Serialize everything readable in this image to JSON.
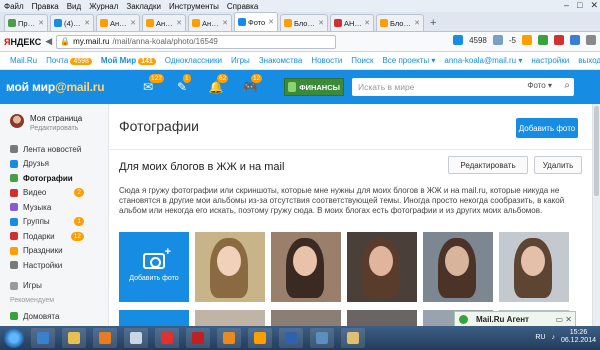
{
  "menubar": {
    "items": [
      "Файл",
      "Правка",
      "Вид",
      "Журнал",
      "Закладки",
      "Инструменты",
      "Справка"
    ]
  },
  "tabs": [
    {
      "label": "Прокурат",
      "icon_color": "#4a9e4a",
      "active": false
    },
    {
      "label": "(4) Входя",
      "icon_color": "#168de2",
      "active": false
    },
    {
      "label": "Анна Вяч",
      "icon_color": "#ff9e00",
      "active": false
    },
    {
      "label": "Анна Вяч",
      "icon_color": "#ff9e00",
      "active": false
    },
    {
      "label": "Анна Вяч",
      "icon_color": "#ff9e00",
      "active": false
    },
    {
      "label": "Фото",
      "icon_color": "#168de2",
      "active": true
    },
    {
      "label": "Блог. Ксен",
      "icon_color": "#ff9e00",
      "active": false
    },
    {
      "label": "АННА ВЯ",
      "icon_color": "#d03030",
      "active": false
    },
    {
      "label": "Блог. Ксен",
      "icon_color": "#ff9e00",
      "active": false
    }
  ],
  "addressbar": {
    "logo_red": "Я",
    "logo_rest": "НДЕКС",
    "host": "my.mail.ru",
    "path": "/mail/anna-koala/photo/16549",
    "mail_count": "4598",
    "temp": "-5"
  },
  "mrnav": {
    "items": [
      {
        "label": "Mail.Ru",
        "bold": false
      },
      {
        "label": "Почта",
        "badge": "4598"
      },
      {
        "label": "Мой Мир",
        "bold": true,
        "badge": "141"
      },
      {
        "label": "Одноклассники"
      },
      {
        "label": "Игры"
      },
      {
        "label": "Знакомства"
      },
      {
        "label": "Новости"
      },
      {
        "label": "Поиск"
      },
      {
        "label": "Все проекты ▾"
      }
    ],
    "user_email": "anna-koala@mail.ru ▾",
    "settings": "настройки",
    "logout": "выход"
  },
  "header": {
    "logo_main": "мой мир",
    "logo_accent": "@mail.ru",
    "icons": [
      {
        "name": "chat-icon",
        "glyph": "✉",
        "count": "122"
      },
      {
        "name": "notifications-icon",
        "glyph": "✎",
        "count": "1"
      },
      {
        "name": "bell-icon",
        "glyph": "🔔",
        "count": "62"
      },
      {
        "name": "games-icon",
        "glyph": "🎮",
        "count": "12"
      }
    ],
    "finance_label": "ФИНАНСЫ",
    "search_placeholder": "Искать в мире",
    "search_scope": "Фото ▾"
  },
  "sidebar": {
    "profile_name": "Моя страница",
    "profile_edit": "Редактировать",
    "items": [
      {
        "label": "Лента новостей",
        "color": "#7a7a7a",
        "badge": ""
      },
      {
        "label": "Друзья",
        "color": "#168de2",
        "badge": ""
      },
      {
        "label": "Фотографии",
        "color": "#4a9e4a",
        "badge": "",
        "active": true
      },
      {
        "label": "Видео",
        "color": "#d03030",
        "badge": "2"
      },
      {
        "label": "Музыка",
        "color": "#8a5ad0",
        "badge": ""
      },
      {
        "label": "Группы",
        "color": "#168de2",
        "badge": "1"
      },
      {
        "label": "Подарки",
        "color": "#d03030",
        "badge": "12"
      },
      {
        "label": "Праздники",
        "color": "#ff9e00",
        "badge": ""
      },
      {
        "label": "Настройки",
        "color": "#7a7a7a",
        "badge": ""
      }
    ],
    "games": "Игры",
    "recommended": "Рекомендуем",
    "last_item": "Домовята"
  },
  "main": {
    "title": "Фотографии",
    "add_photo_btn": "Добавить фото",
    "album_title": "Для моих блогов в ЖЖ и на mail",
    "edit_btn": "Редактировать",
    "delete_btn": "Удалить",
    "album_desc": "Сюда я гружу фотографии или скриншоты, которые мне нужны для моих блогов в ЖЖ и на mail.ru, которые никуда не становятся в другие мои альбомы из-за отсутствия соответствующей темы. Иногда просто некогда сообразить, в какой альбом или некогда его искать, поэтому гружу сюда. В моих блогах есть фотографии и из других моих альбомов.",
    "add_tile_label": "Добавить фото",
    "photos": [
      {
        "bg": "#c9b48a",
        "hair": "#8a6a40",
        "face": "#f0d2bb"
      },
      {
        "bg": "#9a7f6a",
        "hair": "#3a2a22",
        "face": "#e8c3a9"
      },
      {
        "bg": "#4a3f39",
        "hair": "#5a3c2c",
        "face": "#e1b59b"
      },
      {
        "bg": "#7d8792",
        "hair": "#4b3427",
        "face": "#d9b49c"
      },
      {
        "bg": "#c4c9cf",
        "hair": "#5e4433",
        "face": "#e4c0a8"
      }
    ]
  },
  "agent": {
    "label": "Mail.Ru Агент"
  },
  "taskbar": {
    "apps": [
      {
        "name": "ie-icon",
        "color": "#3a7fd0"
      },
      {
        "name": "explorer-icon",
        "color": "#e8c050"
      },
      {
        "name": "media-icon",
        "color": "#e87d20"
      },
      {
        "name": "paint-icon",
        "color": "#c9d6e6"
      },
      {
        "name": "yandex-browser-icon",
        "color": "#e03030"
      },
      {
        "name": "opera-icon",
        "color": "#c02020"
      },
      {
        "name": "firefox-icon",
        "color": "#e88a20"
      },
      {
        "name": "mail-agent-icon",
        "color": "#ff9e00"
      },
      {
        "name": "word-icon",
        "color": "#3060b0"
      },
      {
        "name": "photo-viewer-icon",
        "color": "#5a8fbf"
      },
      {
        "name": "folder-icon",
        "color": "#e0c070"
      }
    ],
    "lang": "RU",
    "time": "15:26",
    "date": "06.12.2014"
  }
}
